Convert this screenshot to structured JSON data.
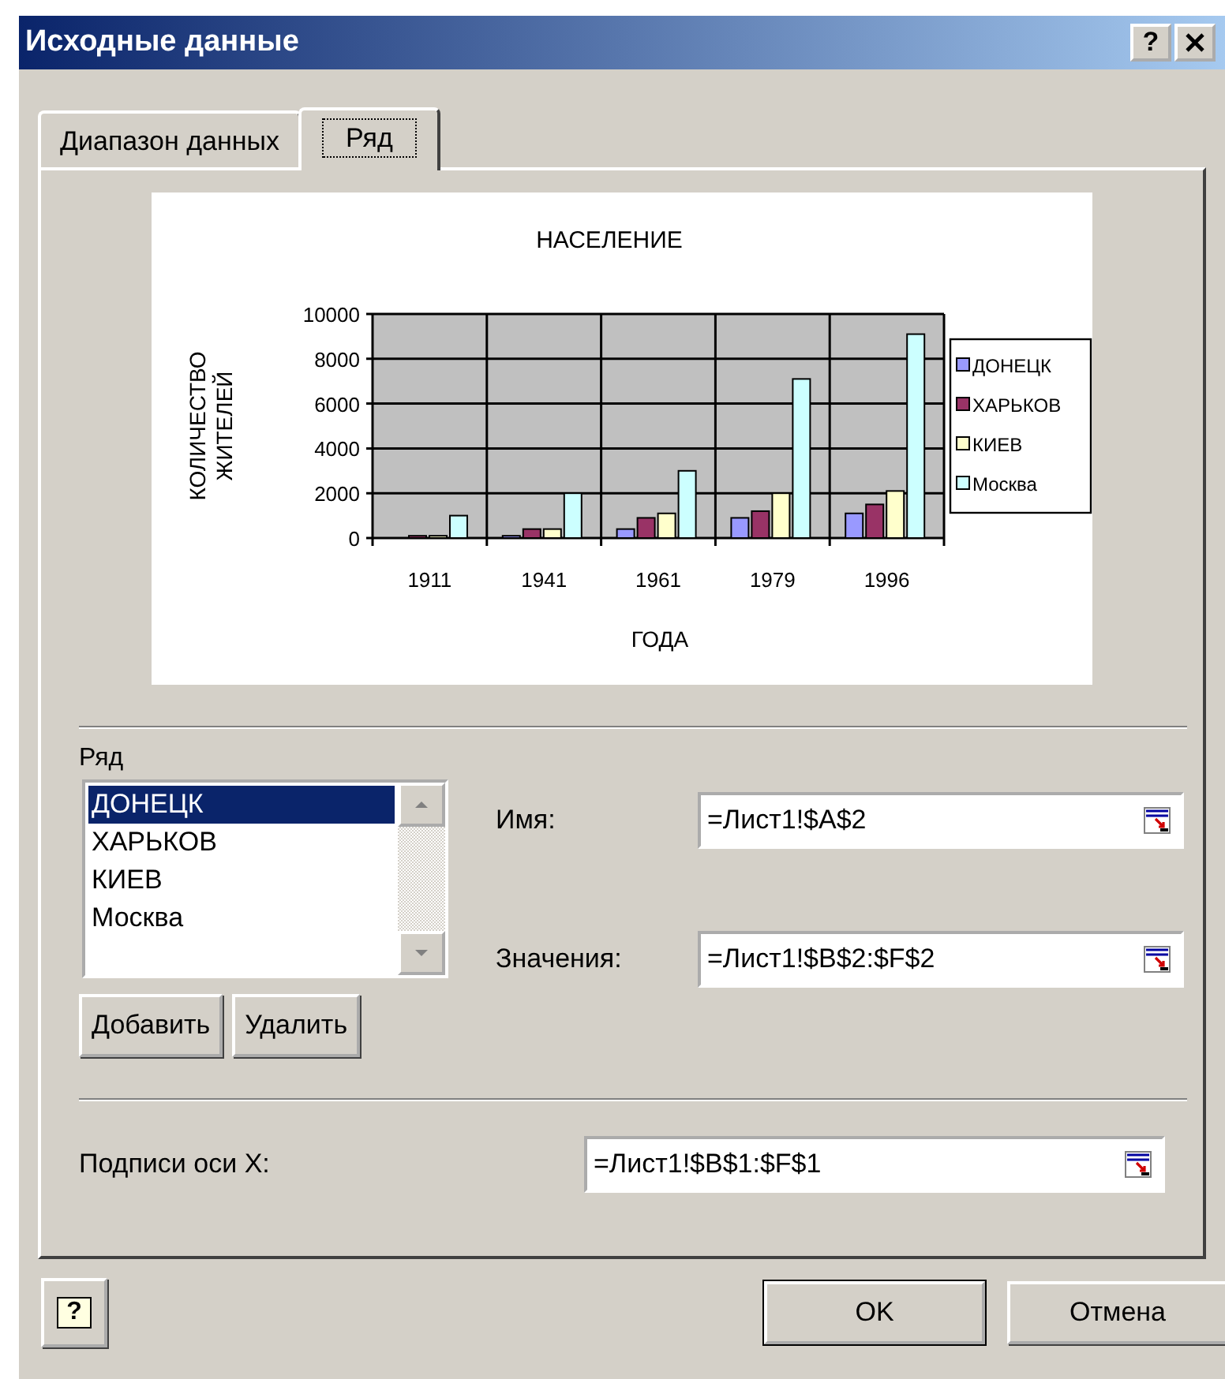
{
  "window": {
    "title": "Исходные данные",
    "help_button": "?"
  },
  "tabs": [
    {
      "label": "Диапазон данных",
      "selected": false
    },
    {
      "label": "Ряд",
      "selected": true
    }
  ],
  "chart_data": {
    "type": "bar",
    "title": "НАСЕЛЕНИЕ",
    "xlabel": "ГОДА",
    "ylabel": "КОЛИЧЕСТВО ЖИТЕЛЕЙ",
    "categories": [
      "1911",
      "1941",
      "1961",
      "1979",
      "1996"
    ],
    "ylim": [
      0,
      10000
    ],
    "grid": true,
    "legend": true,
    "yticks": [
      0,
      2000,
      4000,
      6000,
      8000,
      10000
    ],
    "series": [
      {
        "name": "ДОНЕЦК",
        "color": "#9999ff",
        "values": [
          null,
          100,
          400,
          900,
          1100
        ]
      },
      {
        "name": "ХАРЬКОВ",
        "color": "#993366",
        "values": [
          100,
          400,
          900,
          1200,
          1500
        ]
      },
      {
        "name": "КИЕВ",
        "color": "#ffffcc",
        "values": [
          100,
          400,
          1100,
          2000,
          2100
        ]
      },
      {
        "name": "Москва",
        "color": "#ccffff",
        "values": [
          1000,
          2000,
          3000,
          7100,
          9100
        ]
      }
    ]
  },
  "series_list": {
    "label": "Ряд",
    "items": [
      {
        "label": "ДОНЕЦК",
        "selected": true
      },
      {
        "label": "ХАРЬКОВ",
        "selected": false
      },
      {
        "label": "КИЕВ",
        "selected": false
      },
      {
        "label": "Москва",
        "selected": false
      }
    ],
    "buttons": [
      "Добавить",
      "Удалить"
    ]
  },
  "fields": [
    {
      "label": "Имя:",
      "value": "=Лист1!$A$2"
    },
    {
      "label": "Значения:",
      "value": "=Лист1!$B$2:$F$2"
    }
  ],
  "x_labels": {
    "label": "Подписи оси X:",
    "value": "=Лист1!$B$1:$F$1"
  },
  "footer": {
    "help": "?",
    "ok": "OK",
    "cancel": "Отмена"
  }
}
